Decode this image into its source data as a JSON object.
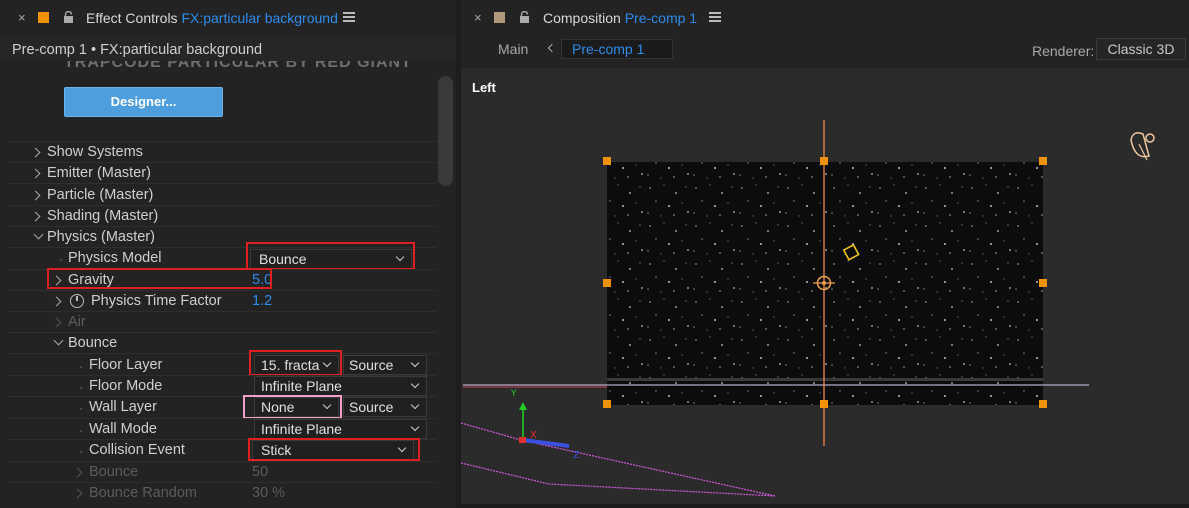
{
  "effect_controls": {
    "tab_close": "×",
    "tab_title": "Effect Controls",
    "tab_target": "FX:particular background",
    "subtitle": "Pre-comp 1 • FX:particular background",
    "banner": "TRAPCODE PARTICULAR BY RED GIANT",
    "designer_button": "Designer...",
    "groups": {
      "show_systems": "Show Systems",
      "emitter": "Emitter (Master)",
      "particle": "Particle (Master)",
      "shading": "Shading (Master)",
      "physics": "Physics (Master)"
    },
    "physics": {
      "model_label": "Physics Model",
      "model_value": "Bounce",
      "gravity_label": "Gravity",
      "gravity_value": "5.0",
      "time_factor_label": "Physics Time Factor",
      "time_factor_value": "1.2",
      "air_label": "Air",
      "bounce_label": "Bounce"
    },
    "bounce": {
      "floor_layer_label": "Floor Layer",
      "floor_layer_value": "15. fracta",
      "floor_layer_source": "Source",
      "floor_mode_label": "Floor Mode",
      "floor_mode_value": "Infinite Plane",
      "wall_layer_label": "Wall Layer",
      "wall_layer_value": "None",
      "wall_layer_source": "Source",
      "wall_mode_label": "Wall Mode",
      "wall_mode_value": "Infinite Plane",
      "collision_label": "Collision Event",
      "collision_value": "Stick",
      "bounce_label": "Bounce",
      "bounce_value": "50",
      "bounce_random_label": "Bounce Random",
      "bounce_random_value": "30 %"
    }
  },
  "composition": {
    "tab_close": "×",
    "tab_title": "Composition",
    "tab_target": "Pre-comp 1",
    "crumb_main": "Main",
    "crumb_current": "Pre-comp 1",
    "renderer_label": "Renderer:",
    "renderer_value": "Classic 3D",
    "view_label": "Left",
    "axis_y": "Y",
    "axis_x": "X",
    "axis_z": "Z"
  },
  "colors": {
    "accent_blue": "#2d8ceb",
    "highlight_red": "#e02020",
    "handle_orange": "#f0920a",
    "label_swatch_orange": "#f0920a",
    "label_swatch_tan": "#b0987a"
  }
}
